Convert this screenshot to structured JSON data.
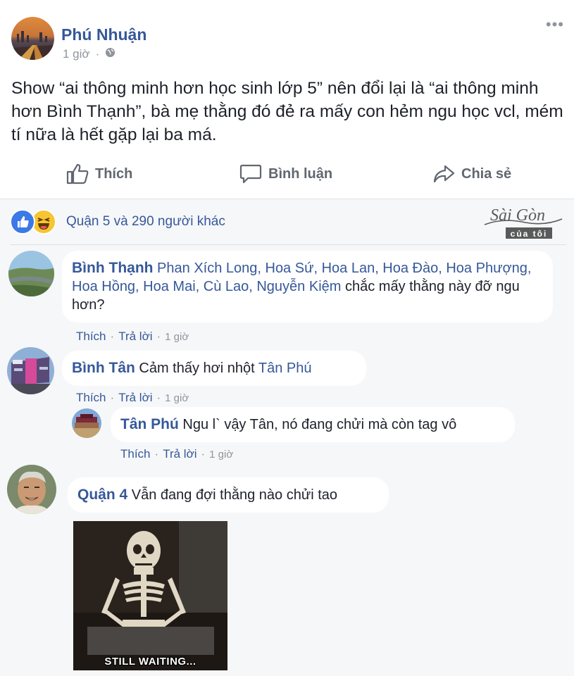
{
  "post": {
    "author": "Phú Nhuận",
    "time": "1 giờ",
    "separator": "·",
    "text": "Show “ai thông minh hơn học sinh lớp 5” nên đổi lại là “ai thông minh hơn Bình Thạnh”, bà mẹ thằng đó đẻ ra mấy con hẻm ngu học vcl, mém tí nữa là hết gặp lại ba má.",
    "actions": {
      "like": "Thích",
      "comment": "Bình luận",
      "share": "Chia sẻ"
    },
    "reactions_text": "Quận 5 và 290 người khác"
  },
  "watermark": {
    "line1": "Sài Gòn",
    "line2": "của tôi"
  },
  "comments": [
    {
      "author": "Bình Thạnh",
      "tags": "Phan Xích Long, Hoa Sứ, Hoa Lan, Hoa Đào, Hoa Phượng, Hoa Hồng, Hoa Mai, Cù Lao, Nguyễn Kiệm",
      "text": "chắc mấy thằng này đỡ ngu hơn?",
      "like": "Thích",
      "reply": "Trả lời",
      "time": "1 giờ"
    },
    {
      "author": "Bình Tân",
      "text": "Cảm thấy hơi nhột",
      "tag": "Tân Phú",
      "like": "Thích",
      "reply": "Trả lời",
      "time": "1 giờ",
      "replies": [
        {
          "author": "Tân Phú",
          "text": "Ngu l` vậy Tân, nó đang chửi mà còn tag vô",
          "like": "Thích",
          "reply": "Trả lời",
          "time": "1 giờ"
        }
      ]
    },
    {
      "author": "Quận 4",
      "text": "Vẫn đang đợi thằng nào chửi tao",
      "image_caption": "STILL WAITING..."
    }
  ],
  "ui": {
    "dot": "·"
  }
}
